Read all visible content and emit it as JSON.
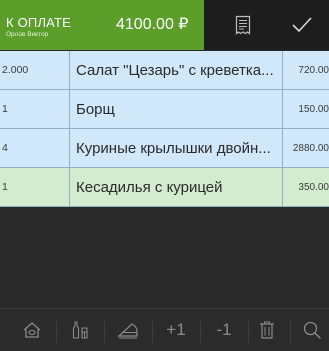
{
  "header": {
    "title": "К ОПЛАТЕ",
    "waiter": "Орлов Виктор",
    "amount": "4100.00 ₽",
    "receipt_icon": "receipt-icon",
    "confirm_icon": "checkmark-icon"
  },
  "order": {
    "rows": [
      {
        "qty": "2.000",
        "name": "Салат \"Цезарь\" с креветка...",
        "sum": "720.00"
      },
      {
        "qty": "1",
        "name": "Борщ",
        "sum": "150.00"
      },
      {
        "qty": "4",
        "name": "Куриные крылышки двойн...",
        "sum": "2880.00"
      },
      {
        "qty": "1",
        "name": "Кесадилья с курицей",
        "sum": "350.00"
      }
    ]
  },
  "toolbar": {
    "home_icon": "home-icon",
    "bottles_icon": "bottles-icon",
    "cake_icon": "cake-slice-icon",
    "plus_label": "+1",
    "minus_label": "-1",
    "trash_icon": "trash-icon",
    "search_icon": "search-icon"
  },
  "colors": {
    "accent_green": "#5b9e2a",
    "row_blue": "#d0e8fa",
    "row_selected": "#d3ebcf",
    "background": "#2a2a2a"
  }
}
